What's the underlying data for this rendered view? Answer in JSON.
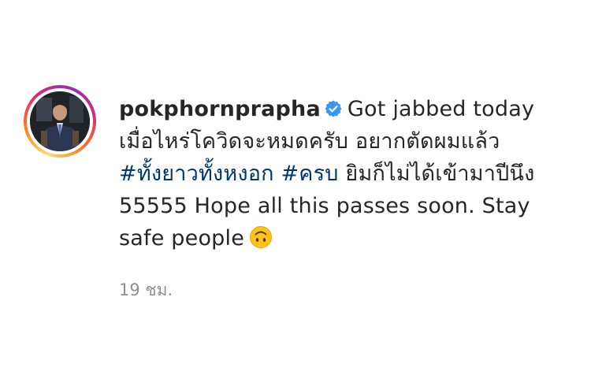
{
  "post": {
    "username": "pokphornprapha",
    "verified": true,
    "caption_lines": [
      "Got jabbed today",
      "เมื่อไหร่โควิดจะหมดครับ อยากตัดผมแล้ว",
      "ยิมก็ไม่ได้เข้ามาปีนึง",
      "55555 Hope all this passes soon. Stay",
      "safe people"
    ],
    "hashtags": [
      "#ทั้งยาวทั้งหงอก",
      "#ครบ"
    ],
    "emoji": "upside-down-face-emoji",
    "timestamp": "19 ชม."
  },
  "colors": {
    "text": "#262626",
    "hashtag": "#00376b",
    "verified_badge": "#3897f0",
    "timestamp": "#8e8e8e",
    "emoji_face": "#fcc21b"
  },
  "icons": [
    "verified-badge-icon",
    "upside-down-face-emoji",
    "avatar"
  ]
}
